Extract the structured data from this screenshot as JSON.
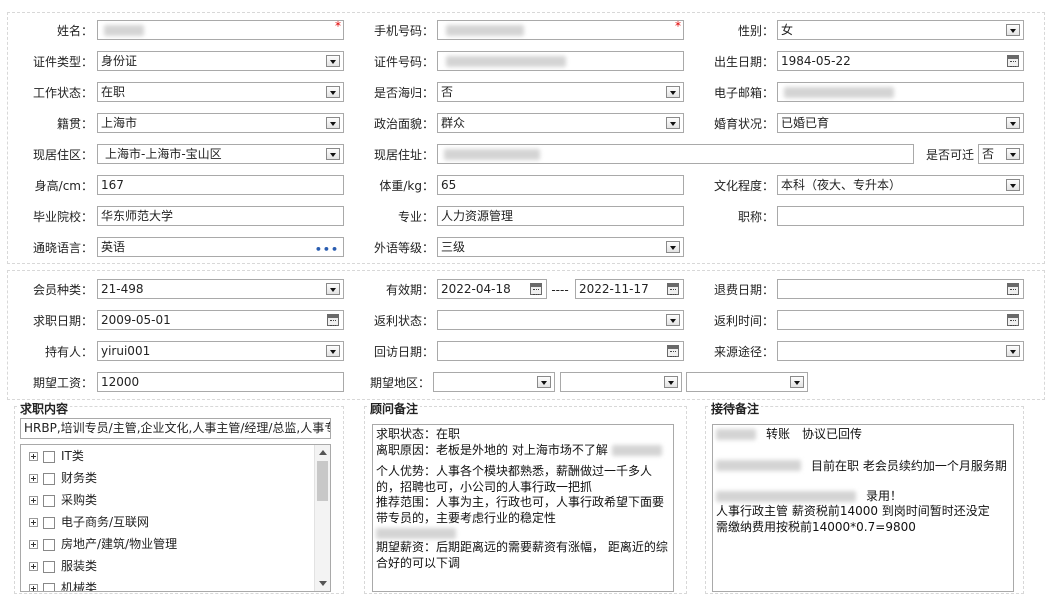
{
  "personal": {
    "name_label": "姓名：",
    "phone_label": "手机号码：",
    "gender_label": "性别：",
    "gender_value": "女",
    "id_type_label": "证件类型：",
    "id_type_value": "身份证",
    "id_number_label": "证件号码：",
    "birth_label": "出生日期：",
    "birth_value": "1984-05-22",
    "work_status_label": "工作状态：",
    "work_status_value": "在职",
    "overseas_label": "是否海归：",
    "overseas_value": "否",
    "email_label": "电子邮箱：",
    "native_label": "籍贯：",
    "native_value": "上海市",
    "political_label": "政治面貌：",
    "political_value": "群众",
    "marital_label": "婚育状况：",
    "marital_value": "已婚已育",
    "residence_area_label": "现居住区：",
    "residence_area_value": "上海市-上海市-宝山区",
    "address_label": "现居住址：",
    "relocate_label": "是否可迁",
    "relocate_value": "否",
    "height_label": "身高/cm：",
    "height_value": "167",
    "weight_label": "体重/kg：",
    "weight_value": "65",
    "education_label": "文化程度：",
    "education_value": "本科（夜大、专升本）",
    "school_label": "毕业院校：",
    "school_value": "华东师范大学",
    "major_label": "专业：",
    "major_value": "人力资源管理",
    "title_label": "职称：",
    "title_value": "",
    "language_label": "通晓语言：",
    "language_value": "英语",
    "language_level_label": "外语等级：",
    "language_level_value": "三级"
  },
  "membership": {
    "member_type_label": "会员种类：",
    "member_type_value": "21-498",
    "validity_label": "有效期：",
    "validity_start": "2022-04-18",
    "validity_sep": "----",
    "validity_end": "2022-11-17",
    "refund_date_label": "退费日期：",
    "refund_date_value": "",
    "job_date_label": "求职日期：",
    "job_date_value": "2009-05-01",
    "rebate_status_label": "返利状态：",
    "rebate_status_value": "",
    "rebate_time_label": "返利时间：",
    "rebate_time_value": "",
    "holder_label": "持有人：",
    "holder_value": "yirui001",
    "visit_date_label": "回访日期：",
    "visit_date_value": "",
    "source_label": "来源途径：",
    "source_value": "",
    "salary_label": "期望工资：",
    "salary_value": "12000",
    "region_label": "期望地区：",
    "region_values": [
      "",
      "",
      ""
    ]
  },
  "job_panel": {
    "title": "求职内容",
    "summary": "HRBP,培训专员/主管,企业文化,人事主管/经理/总监,人事专",
    "categories": [
      "IT类",
      "财务类",
      "采购类",
      "电子商务/互联网",
      "房地产/建筑/物业管理",
      "服装类",
      "机械类"
    ]
  },
  "advisor_panel": {
    "title": "顾问备注",
    "lines": [
      "求职状态：在职",
      "离职原因：老板是外地的 对上海市场不了解",
      "",
      "个人优势：人事各个模块都熟悉，薪酬做过一千多人的，招聘也可，小公司的人事行政一把抓",
      "推荐范围：人事为主，行政也可，人事行政希望下面要带专员的，主要考虑行业的稳定性",
      "",
      "期望薪资：后期距离远的需要薪资有涨幅， 距离近的综合好的可以下调"
    ]
  },
  "reception_panel": {
    "title": "接待备注",
    "lines": [
      "转账　协议已回传",
      "",
      "目前在职 老会员续约加一个月服务期",
      "",
      "录用！",
      "人事行政主管 薪资税前14000 到岗时间暂时还没定",
      "需缴纳费用按税前14000*0.7=9800"
    ]
  }
}
